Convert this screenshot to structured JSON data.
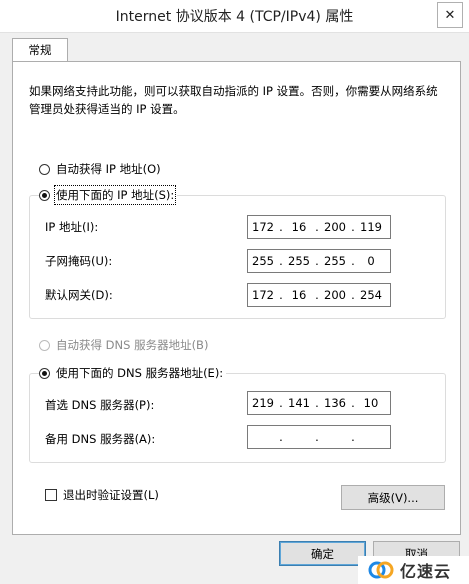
{
  "window": {
    "title": "Internet 协议版本 4 (TCP/IPv4) 属性",
    "close_glyph": "✕"
  },
  "tabs": [
    {
      "label": "常规"
    }
  ],
  "description": "如果网络支持此功能，则可以获取自动指派的 IP 设置。否则，你需要从网络系统管理员处获得适当的 IP 设置。",
  "ip_mode": {
    "auto_label": "自动获得 IP 地址(O)",
    "manual_label": "使用下面的 IP 地址(S):",
    "selected": "manual"
  },
  "ip_fields": {
    "address": {
      "label": "IP 地址(I):",
      "octets": [
        "172",
        "16",
        "200",
        "119"
      ]
    },
    "subnet": {
      "label": "子网掩码(U):",
      "octets": [
        "255",
        "255",
        "255",
        "0"
      ]
    },
    "gateway": {
      "label": "默认网关(D):",
      "octets": [
        "172",
        "16",
        "200",
        "254"
      ]
    }
  },
  "dns_mode": {
    "auto_label": "自动获得 DNS 服务器地址(B)",
    "manual_label": "使用下面的 DNS 服务器地址(E):",
    "selected": "manual"
  },
  "dns_fields": {
    "preferred": {
      "label": "首选 DNS 服务器(P):",
      "octets": [
        "219",
        "141",
        "136",
        "10"
      ]
    },
    "alternate": {
      "label": "备用 DNS 服务器(A):",
      "octets": [
        "",
        "",
        "",
        ""
      ]
    }
  },
  "validate": {
    "label": "退出时验证设置(L)",
    "checked": false
  },
  "buttons": {
    "advanced": "高级(V)...",
    "ok": "确定",
    "cancel": "取消"
  },
  "watermark": {
    "text": "亿速云",
    "icon": "cloud-logo-icon"
  },
  "colors": {
    "window_bg": "#f0f0f0",
    "panel_bg": "#ffffff",
    "default_button_border": "#3c7fb1",
    "watermark_blue": "#1e88e5",
    "watermark_orange": "#f5a623"
  }
}
